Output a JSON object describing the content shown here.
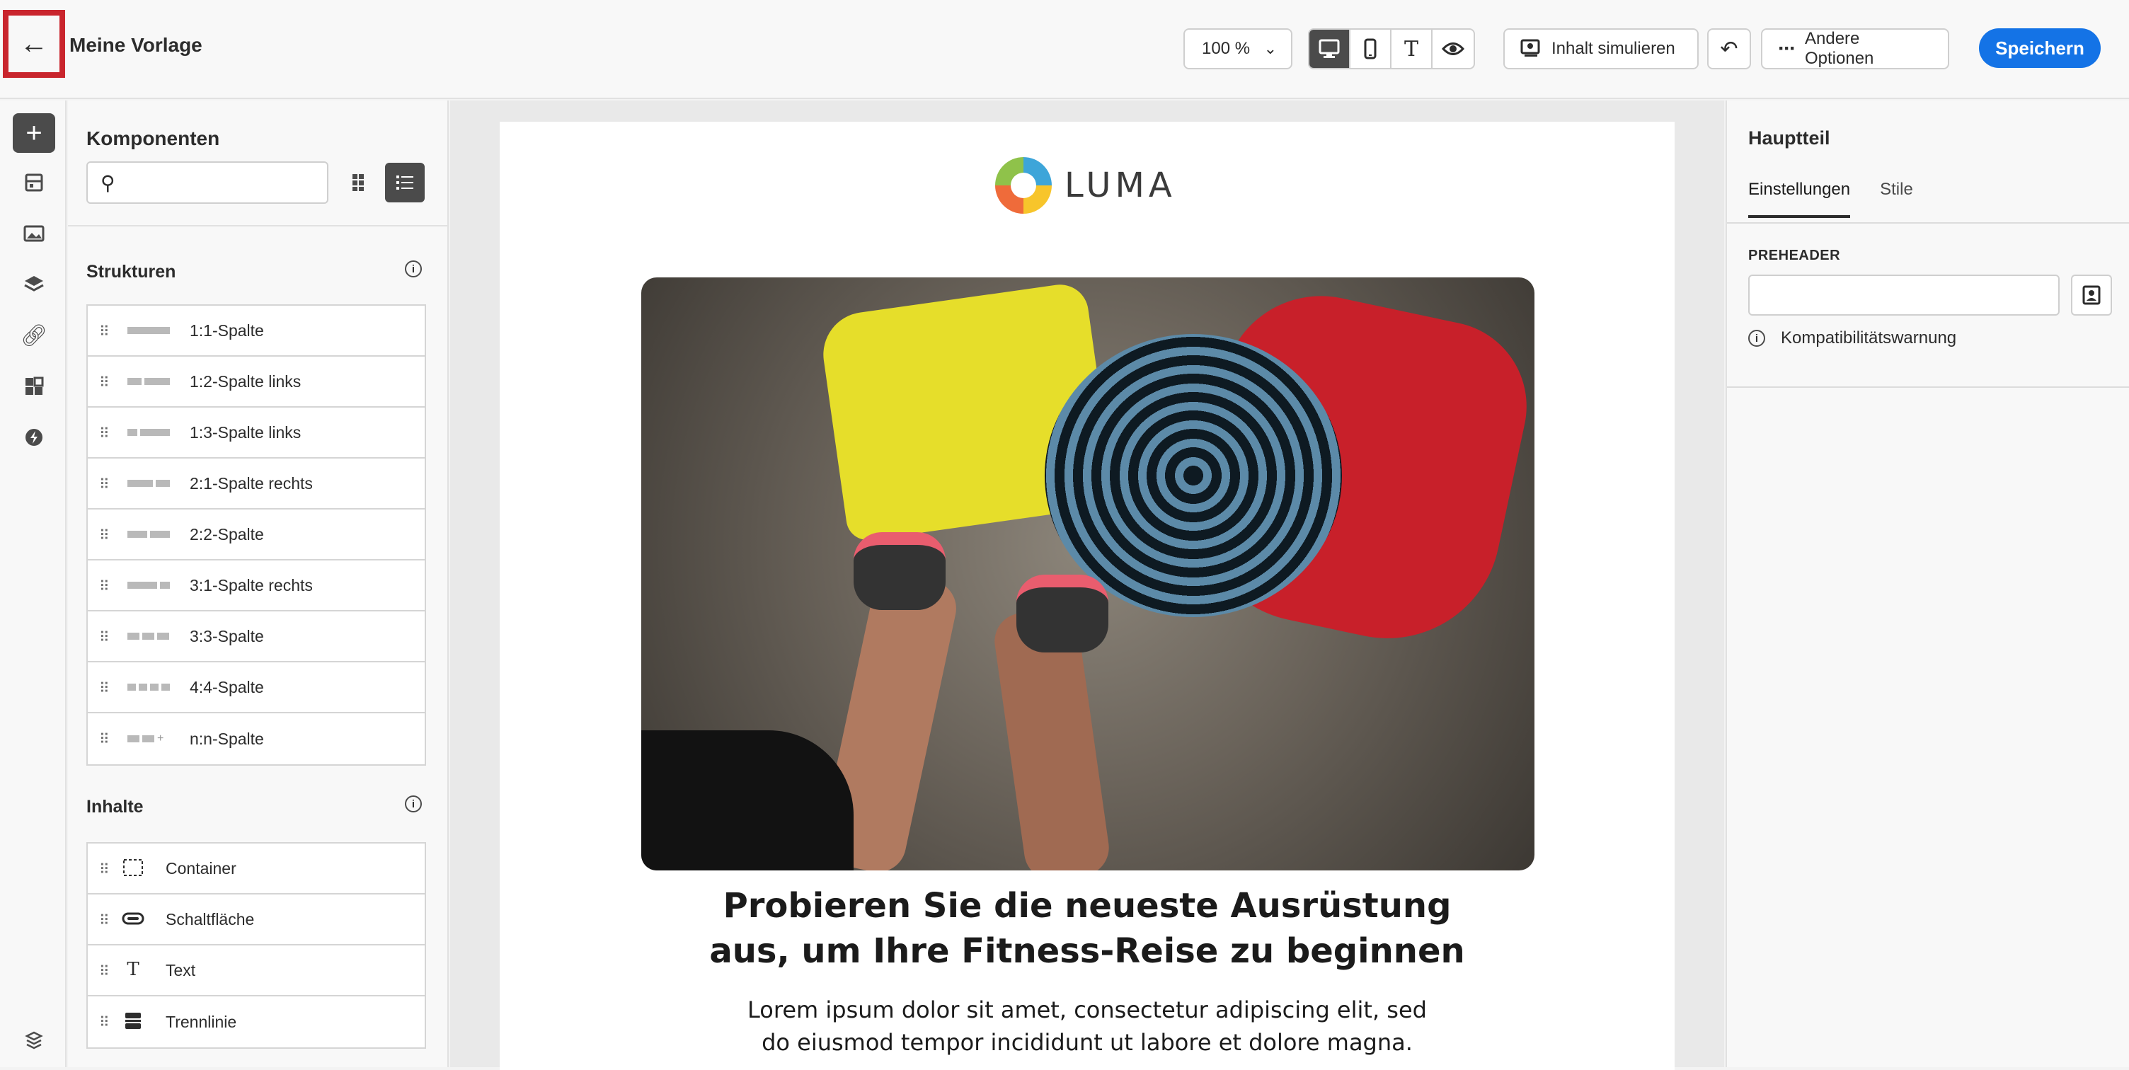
{
  "header": {
    "title": "Meine Vorlage",
    "zoom": "100 %",
    "simulate_label": "Inhalt simulieren",
    "more_options_label": "Andere Optionen",
    "save_label": "Speichern"
  },
  "components_panel": {
    "title": "Komponenten",
    "search_placeholder": "",
    "structures_title": "Strukturen",
    "structures": [
      {
        "label": "1:1-Spalte"
      },
      {
        "label": "1:2-Spalte links"
      },
      {
        "label": "1:3-Spalte links"
      },
      {
        "label": "2:1-Spalte rechts"
      },
      {
        "label": "2:2-Spalte"
      },
      {
        "label": "3:1-Spalte rechts"
      },
      {
        "label": "3:3-Spalte"
      },
      {
        "label": "4:4-Spalte"
      },
      {
        "label": "n:n-Spalte"
      }
    ],
    "contents_title": "Inhalte",
    "contents": [
      {
        "label": "Container"
      },
      {
        "label": "Schaltfläche"
      },
      {
        "label": "Text"
      },
      {
        "label": "Trennlinie"
      }
    ]
  },
  "email": {
    "logo_text": "LUMA",
    "headline_line1": "Probieren Sie die neueste Ausrüstung",
    "headline_line2": "aus, um Ihre Fitness-Reise zu beginnen",
    "body_line1": "Lorem ipsum dolor sit amet, consectetur adipiscing elit, sed",
    "body_line2": "do eiusmod tempor incididunt ut labore et dolore magna."
  },
  "properties_panel": {
    "title": "Hauptteil",
    "tabs": [
      {
        "label": "Einstellungen"
      },
      {
        "label": "Stile"
      }
    ],
    "preheader_label": "PREHEADER",
    "preheader_value": "",
    "warning_text": "Kompatibilitätswarnung"
  },
  "colors": {
    "accent": "#1473e6",
    "highlight": "#c9252d",
    "active_dark": "#4b4b4b"
  }
}
